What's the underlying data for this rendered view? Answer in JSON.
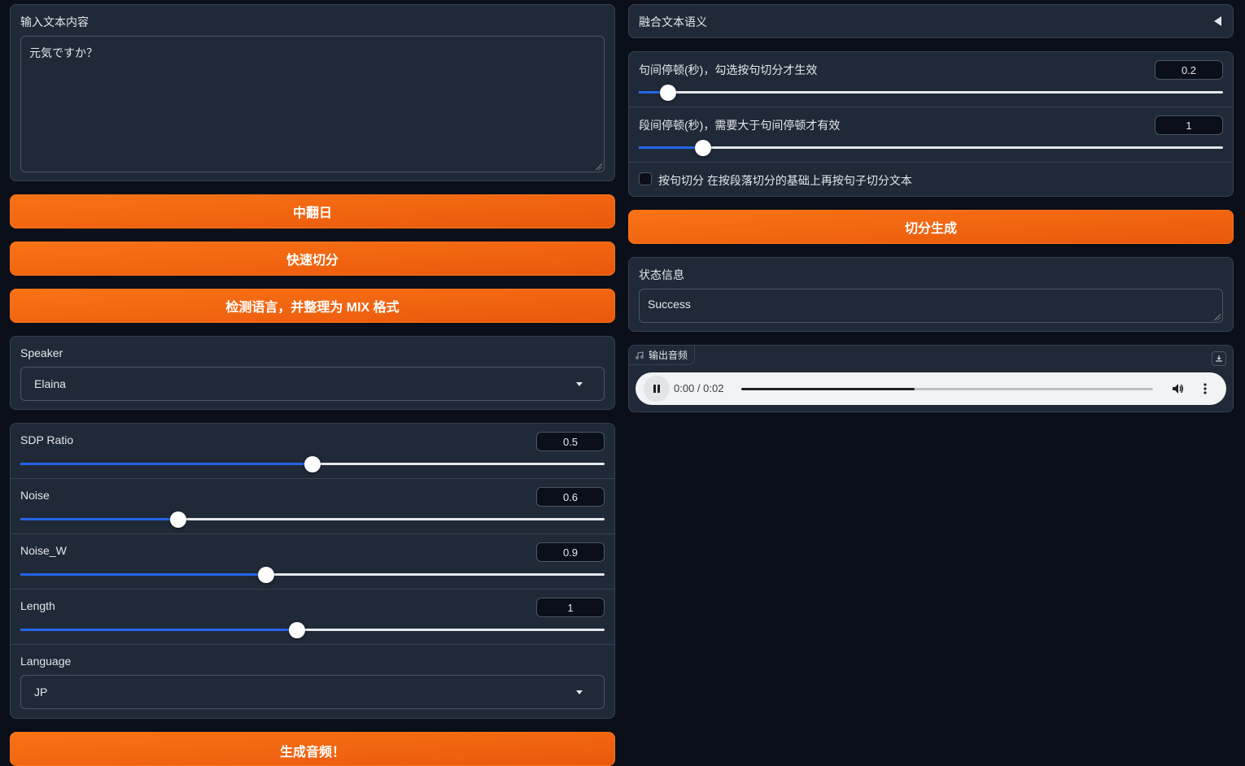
{
  "left": {
    "text_input": {
      "label": "输入文本内容",
      "value": "元気ですか？"
    },
    "buttons": {
      "translate": "中翻日",
      "quick_split": "快速切分",
      "detect_language": "检测语言，并整理为 MIX 格式",
      "generate": "生成音频！"
    },
    "speaker": {
      "label": "Speaker",
      "value": "Elaina"
    },
    "sliders": [
      {
        "label": "SDP Ratio",
        "value": "0.5",
        "fraction": 0.5
      },
      {
        "label": "Noise",
        "value": "0.6",
        "fraction": 0.27
      },
      {
        "label": "Noise_W",
        "value": "0.9",
        "fraction": 0.42
      },
      {
        "label": "Length",
        "value": "1",
        "fraction": 0.474
      }
    ],
    "language": {
      "label": "Language",
      "value": "JP"
    }
  },
  "right": {
    "accordion": {
      "label": "融合文本语义"
    },
    "sliders": [
      {
        "label": "句间停顿(秒)，勾选按句切分才生效",
        "value": "0.2",
        "fraction": 0.05
      },
      {
        "label": "段间停顿(秒)，需要大于句间停顿才有效",
        "value": "1",
        "fraction": 0.11
      }
    ],
    "checkbox": {
      "label": "按句切分 在按段落切分的基础上再按句子切分文本",
      "checked": false
    },
    "split_button": "切分生成",
    "status": {
      "label": "状态信息",
      "value": "Success"
    },
    "audio": {
      "label": "输出音频",
      "time": "0:00 / 0:02",
      "progress": 0.42
    }
  },
  "colors": {
    "accent": "#f97316",
    "slider_fill": "#2563eb",
    "background": "#0b0f19",
    "panel": "#1f2937"
  }
}
